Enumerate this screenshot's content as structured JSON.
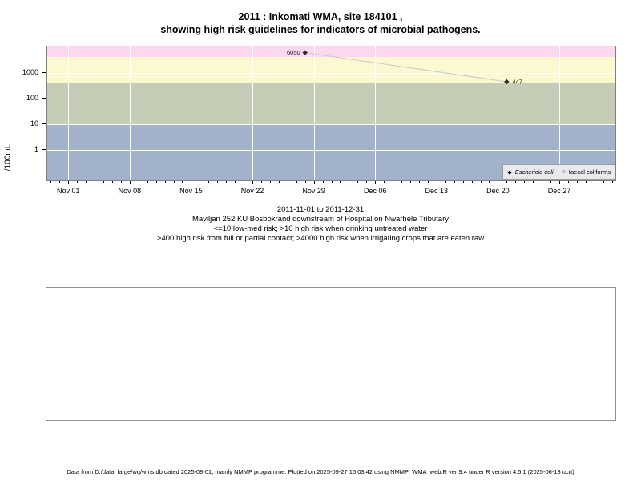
{
  "title": {
    "line1": "2011 : Inkomati WMA, site 184101 ,",
    "line2": "showing high risk guidelines for indicators of microbial pathogens."
  },
  "chart_data": {
    "type": "line",
    "ylabel": "/100mL",
    "x_unit": "days since 2011-11-01",
    "xlim": [
      -2.4,
      62.4
    ],
    "ylim_log10": [
      -1.18,
      4.02
    ],
    "x_ticks": [
      {
        "day": 0,
        "label": "Nov 01"
      },
      {
        "day": 7,
        "label": "Nov 08"
      },
      {
        "day": 14,
        "label": "Nov 15"
      },
      {
        "day": 21,
        "label": "Nov 22"
      },
      {
        "day": 28,
        "label": "Nov 29"
      },
      {
        "day": 35,
        "label": "Dec 06"
      },
      {
        "day": 42,
        "label": "Dec 13"
      },
      {
        "day": 49,
        "label": "Dec 20"
      },
      {
        "day": 56,
        "label": "Dec 27"
      }
    ],
    "x_minor_tick_step_days": 1,
    "y_ticks": [
      {
        "value": 1,
        "label": "1"
      },
      {
        "value": 10,
        "label": "10"
      },
      {
        "value": 100,
        "label": "100"
      },
      {
        "value": 1000,
        "label": "1000"
      }
    ],
    "grid": true,
    "grid_color": "#ffffff",
    "bands": [
      {
        "id": "low-med-risk",
        "from": null,
        "to": 10,
        "color": "#a2b2ca"
      },
      {
        "id": "high-risk-drinking",
        "from": 10,
        "to": 400,
        "color": "#c6cdb7"
      },
      {
        "id": "high-risk-contact",
        "from": 400,
        "to": 4000,
        "color": "#fcf9d0"
      },
      {
        "id": "high-risk-irrigation",
        "from": 4000,
        "to": null,
        "color": "#fbd7f2"
      }
    ],
    "series": [
      {
        "name": "Eschericia coli",
        "marker": "filled-diamond",
        "line_color": "#cdcdcd",
        "marker_color": "#2b2b2b",
        "points": [
          {
            "day": 27,
            "date": "2011-11-28",
            "value": 6050,
            "label": "6050",
            "label_side": "left"
          },
          {
            "day": 50,
            "date": "2011-12-21",
            "value": 447,
            "label": "447",
            "label_side": "right"
          }
        ]
      },
      {
        "name": "faecal coliforms",
        "marker": "open-circle",
        "points": []
      }
    ],
    "legend_position": "bottom-right"
  },
  "legend": {
    "items": [
      {
        "marker": "◆",
        "label": "Eschericia coli",
        "italic": true
      },
      {
        "marker": "○",
        "label": "faecal coliforms",
        "italic": false
      }
    ]
  },
  "captions": [
    "2011-11-01 to 2011-12-31",
    "Maviljan 252 KU Bosbokrand downstream of Hospital on Nwarhele Tributary",
    "<=10 low-med risk; >10 high risk when drinking untreated water",
    ">400 high risk from full or partial contact; >4000 high risk when irrigating crops that are eaten raw"
  ],
  "footer": "Data from D:/data_large/wq/wms.db dated 2025-08-01, mainly NMMP programme. Plotted on 2025-09-27 15:03:42 using NMMP_WMA_web.R ver 9.4 under R version 4.5.1 (2025-06-13 ucrt)"
}
